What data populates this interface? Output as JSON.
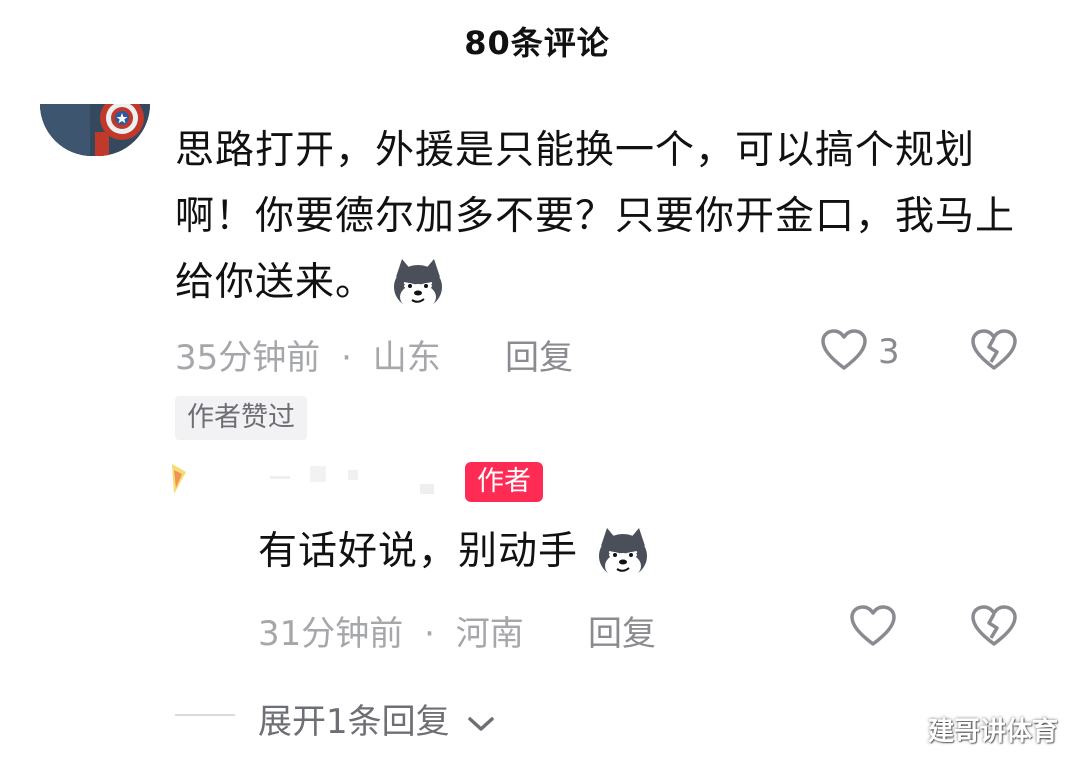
{
  "header": {
    "title": "80条评论"
  },
  "comment": {
    "text": "思路打开，外援是只能换一个，可以搞个规划啊！你要德尔加多不要？只要你开金口，我马上给你送来。",
    "time": "35分钟前",
    "location": "山东",
    "reply_label": "回复",
    "like_count": "3",
    "author_liked_badge": "作者赞过",
    "emoji_icon": "husky-smirk-emoji"
  },
  "reply": {
    "author_tag": "作者",
    "text": "有话好说，别动手",
    "time": "31分钟前",
    "location": "河南",
    "reply_label": "回复",
    "emoji_icon": "husky-smirk-emoji"
  },
  "expand": {
    "label": "展开1条回复"
  },
  "watermark": "建哥讲体育",
  "colors": {
    "author_tag_bg": "#fe2c55",
    "meta_text": "#a6a7ab",
    "icon_stroke": "#8a8b90"
  },
  "separator": "·"
}
